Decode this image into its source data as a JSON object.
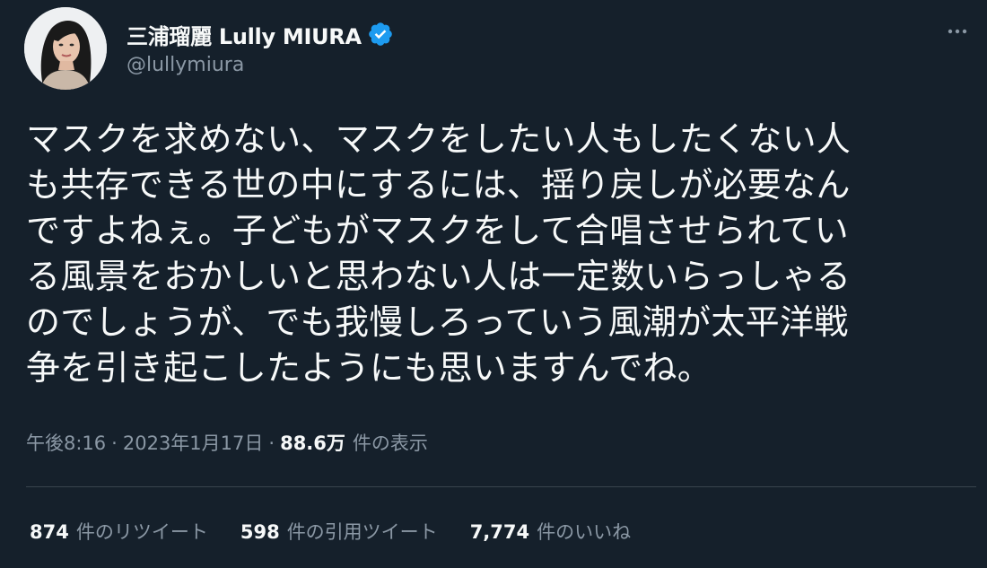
{
  "author": {
    "display_name": "三浦瑠麗 Lully MIURA",
    "handle": "@lullymiura",
    "verified_icon": "verified-badge-icon",
    "avatar_icon": "profile-photo"
  },
  "menu": {
    "icon": "more-options-icon"
  },
  "tweet": {
    "text": "マスクを求めない、マスクをしたい人もしたくない人\nも共存できる世の中にするには、揺り戻しが必要なん\nですよねぇ。子どもがマスクをして合唱させられてい\nる風景をおかしいと思わない人は一定数いらっしゃる\nのでしょうが、でも我慢しろっていう風潮が太平洋戦\n争を引き起こしたようにも思いますんでね。"
  },
  "meta": {
    "time": "午後8:16",
    "separator": "·",
    "date": "2023年1月17日",
    "views_count": "88.6万",
    "views_label": "件の表示"
  },
  "stats": [
    {
      "count": "874",
      "label": "件のリツイート"
    },
    {
      "count": "598",
      "label": "件の引用ツイート"
    },
    {
      "count": "7,774",
      "label": "件のいいね"
    }
  ],
  "colors": {
    "background": "#15202b",
    "text": "#f7f9f9",
    "secondary": "#8b98a5",
    "verified": "#1d9bf0",
    "divider": "#38444d"
  }
}
